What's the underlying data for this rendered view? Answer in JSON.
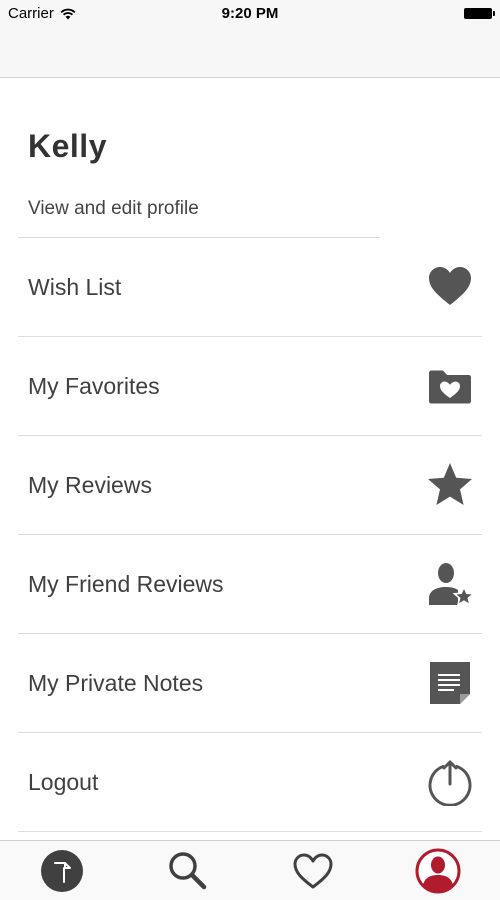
{
  "status_bar": {
    "carrier": "Carrier",
    "time": "9:20 PM"
  },
  "profile": {
    "name": "Kelly",
    "edit_link": "View and edit profile"
  },
  "menu": [
    {
      "label": "Wish List",
      "icon": "heart-icon"
    },
    {
      "label": "My Favorites",
      "icon": "heart-folder-icon"
    },
    {
      "label": "My Reviews",
      "icon": "star-icon"
    },
    {
      "label": "My Friend Reviews",
      "icon": "friend-star-icon"
    },
    {
      "label": "My Private Notes",
      "icon": "note-icon"
    },
    {
      "label": "Logout",
      "icon": "power-icon"
    }
  ],
  "tab_bar": [
    {
      "icon": "app-logo-icon"
    },
    {
      "icon": "search-icon"
    },
    {
      "icon": "heart-outline-icon"
    },
    {
      "icon": "profile-avatar-icon",
      "active": true
    }
  ],
  "colors": {
    "icon": "#555555",
    "text": "#404040",
    "active_tab": "#b01c2e",
    "divider": "#dcdcdc"
  }
}
